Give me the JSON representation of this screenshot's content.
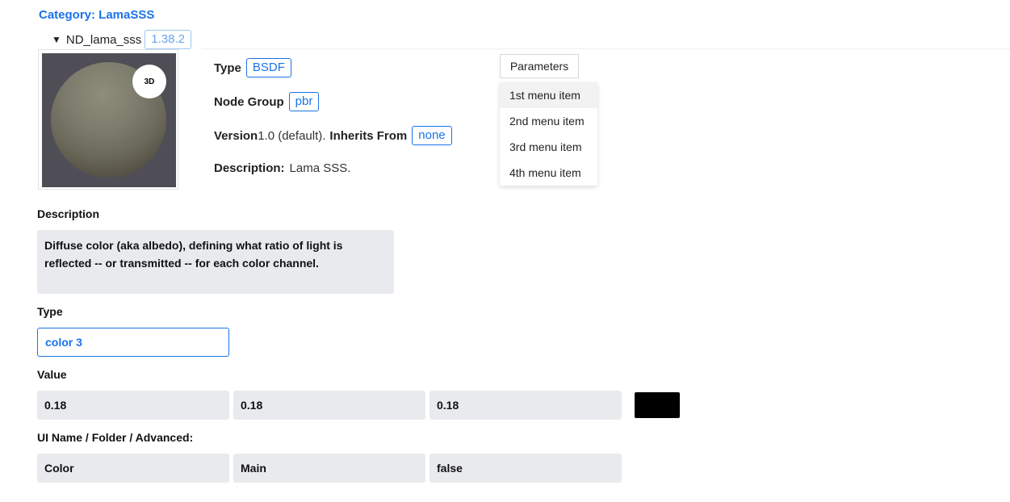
{
  "category": {
    "label": "Category: LamaSSS"
  },
  "node": {
    "name": "ND_lama_sss",
    "version": "1.38.2"
  },
  "preview": {
    "badge": "3D"
  },
  "info": {
    "type_label": "Type",
    "type_value": "BSDF",
    "group_label": "Node Group",
    "group_value": "pbr",
    "version_label": "Version",
    "version_value": "1.0 (default).",
    "inherits_label": "Inherits From",
    "inherits_value": "none",
    "description_label": "Description:",
    "description_value": "Lama SSS."
  },
  "parameters": {
    "button_label": "Parameters",
    "menu_items": [
      "1st menu item",
      "2nd menu item",
      "3rd menu item",
      "4th menu item"
    ]
  },
  "input": {
    "description_label": "Description",
    "description_text": "Diffuse color (aka albedo), defining what ratio of light is reflected -- or transmitted -- for each color channel.",
    "type_label": "Type",
    "type_value": "color 3",
    "value_label": "Value",
    "values": [
      "0.18",
      "0.18",
      "0.18"
    ],
    "swatch_color": "#000000",
    "ui_label": "UI Name / Folder / Advanced:",
    "ui_values": [
      "Color",
      "Main",
      "false"
    ]
  }
}
